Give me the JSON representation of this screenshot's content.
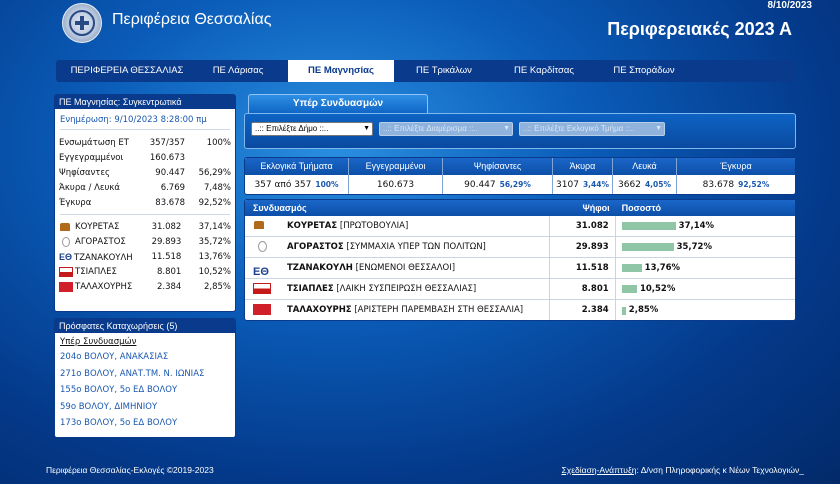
{
  "header": {
    "site_title": "Περιφέρεια Θεσσαλίας",
    "date": "8/10/2023",
    "election_title": "Περιφερειακές 2023 Α"
  },
  "nav": [
    {
      "label": "ΠΕΡΙΦΕΡΕΙΑ ΘΕΣΣΑΛΙΑΣ",
      "active": false
    },
    {
      "label": "ΠΕ Λάρισας",
      "active": false
    },
    {
      "label": "ΠΕ Μαγνησίας",
      "active": true
    },
    {
      "label": "ΠΕ Τρικάλων",
      "active": false
    },
    {
      "label": "ΠΕ Καρδίτσας",
      "active": false
    },
    {
      "label": "ΠΕ Σποράδων",
      "active": false
    }
  ],
  "summary": {
    "title": "ΠΕ Μαγνησίας: Συγκεντρωτικά",
    "updated": "Ενημέρωση: 9/10/2023 8:28:00 πμ",
    "rows": [
      {
        "label": "Ενσωμάτωση ΕΤ",
        "value": "357/357",
        "pct": "100%"
      },
      {
        "label": "Εγγεγραμμένοι",
        "value": "160.673",
        "pct": ""
      },
      {
        "label": "Ψηφίσαντες",
        "value": "90.447",
        "pct": "56,29%"
      },
      {
        "label": "Άκυρα / Λευκά",
        "value": "6.769",
        "pct": "7,48%"
      },
      {
        "label": "Έγκυρα",
        "value": "83.678",
        "pct": "92,52%"
      }
    ],
    "parties": [
      {
        "name": "ΚΟΥΡΕΤΑΣ",
        "votes": "31.082",
        "pct": "37,14%",
        "icon": "kouretas-logo-icon"
      },
      {
        "name": "ΑΓΟΡΑΣΤΟΣ",
        "votes": "29.893",
        "pct": "35,72%",
        "icon": "agorastos-logo-icon"
      },
      {
        "name": "ΤΖΑΝΑΚΟΥΛΗ",
        "votes": "11.518",
        "pct": "13,76%",
        "icon": "tzanakouli-logo-icon"
      },
      {
        "name": "ΤΣΙΑΠΛΕΣ",
        "votes": "8.801",
        "pct": "10,52%",
        "icon": "tsiaples-logo-icon"
      },
      {
        "name": "ΤΑΛΑΧΟΥΡΗΣ",
        "votes": "2.384",
        "pct": "2,85%",
        "icon": "talaxouris-logo-icon"
      }
    ]
  },
  "recent": {
    "title": "Πρόσφατες Καταχωρήσεις (5)",
    "subtitle": "Υπέρ Συνδυασμών",
    "items": [
      "204ο ΒΟΛΟΥ, ΑΝΑΚΑΣΙΑΣ",
      "271ο ΒΟΛΟΥ, ΑΝΑΤ.ΤΜ. Ν. ΙΩΝΙΑΣ",
      "155ο ΒΟΛΟΥ, 5ο ΕΔ ΒΟΛΟΥ",
      "59ο ΒΟΛΟΥ, ΔΙΜΗΝΙΟΥ",
      "173ο ΒΟΛΟΥ, 5ο ΕΔ ΒΟΛΟΥ"
    ]
  },
  "tab_label": "Υπέρ Συνδυασμών",
  "filters": {
    "municipality": "..:: Επιλέξτε Δήμο ::..",
    "district": "..:: Επιλέξτε Διαμέρισμα ::..",
    "section": "..:: Επιλέξτε Εκλογικό Τμήμα ::.."
  },
  "stats": {
    "headers": [
      "Εκλογικά Τμήματα",
      "Εγγεγραμμένοι",
      "Ψηφίσαντες",
      "Άκυρα",
      "Λευκά",
      "Έγκυρα"
    ],
    "values": [
      {
        "value": "357 από 357",
        "pct": "100%"
      },
      {
        "value": "160.673",
        "pct": ""
      },
      {
        "value": "90.447",
        "pct": "56,29%"
      },
      {
        "value": "3107",
        "pct": "3,44%"
      },
      {
        "value": "3662",
        "pct": "4,05%"
      },
      {
        "value": "83.678",
        "pct": "92,52%"
      }
    ]
  },
  "results": {
    "headers": {
      "party": "Συνδυασμός",
      "votes": "Ψήφοι",
      "pct": "Ποσοστό"
    },
    "rows": [
      {
        "name": "ΚΟΥΡΕΤΑΣ",
        "full": "[ΠΡΩΤΟΒΟΥΛΙΑ]",
        "votes": "31.082",
        "pct": "37,14%",
        "share": 37.14
      },
      {
        "name": "ΑΓΟΡΑΣΤΟΣ",
        "full": "[ΣΥΜΜΑΧΙΑ ΥΠΕΡ ΤΩΝ ΠΟΛΙΤΩΝ]",
        "votes": "29.893",
        "pct": "35,72%",
        "share": 35.72
      },
      {
        "name": "ΤΖΑΝΑΚΟΥΛΗ",
        "full": "[ΕΝΩΜΕΝΟΙ ΘΕΣΣΑΛΟΙ]",
        "votes": "11.518",
        "pct": "13,76%",
        "share": 13.76
      },
      {
        "name": "ΤΣΙΑΠΛΕΣ",
        "full": "[ΛΑΙΚΗ ΣΥΣΠΕΙΡΩΣΗ ΘΕΣΣΑΛΙΑΣ]",
        "votes": "8.801",
        "pct": "10,52%",
        "share": 10.52
      },
      {
        "name": "ΤΑΛΑΧΟΥΡΗΣ",
        "full": "[ΑΡΙΣΤΕΡΗ ΠΑΡΕΜΒΑΣΗ ΣΤΗ ΘΕΣΣΑΛΙΑ]",
        "votes": "2.384",
        "pct": "2,85%",
        "share": 2.85
      }
    ]
  },
  "footer": {
    "left": "Περιφέρεια Θεσσαλίας-Εκλογές ©2019-2023",
    "right_link": "Σχεδίαση-Ανάπτυξη",
    "right_text": ": Δ/νση Πληροφορικής κ Νέων Τεχνολογιών_"
  }
}
